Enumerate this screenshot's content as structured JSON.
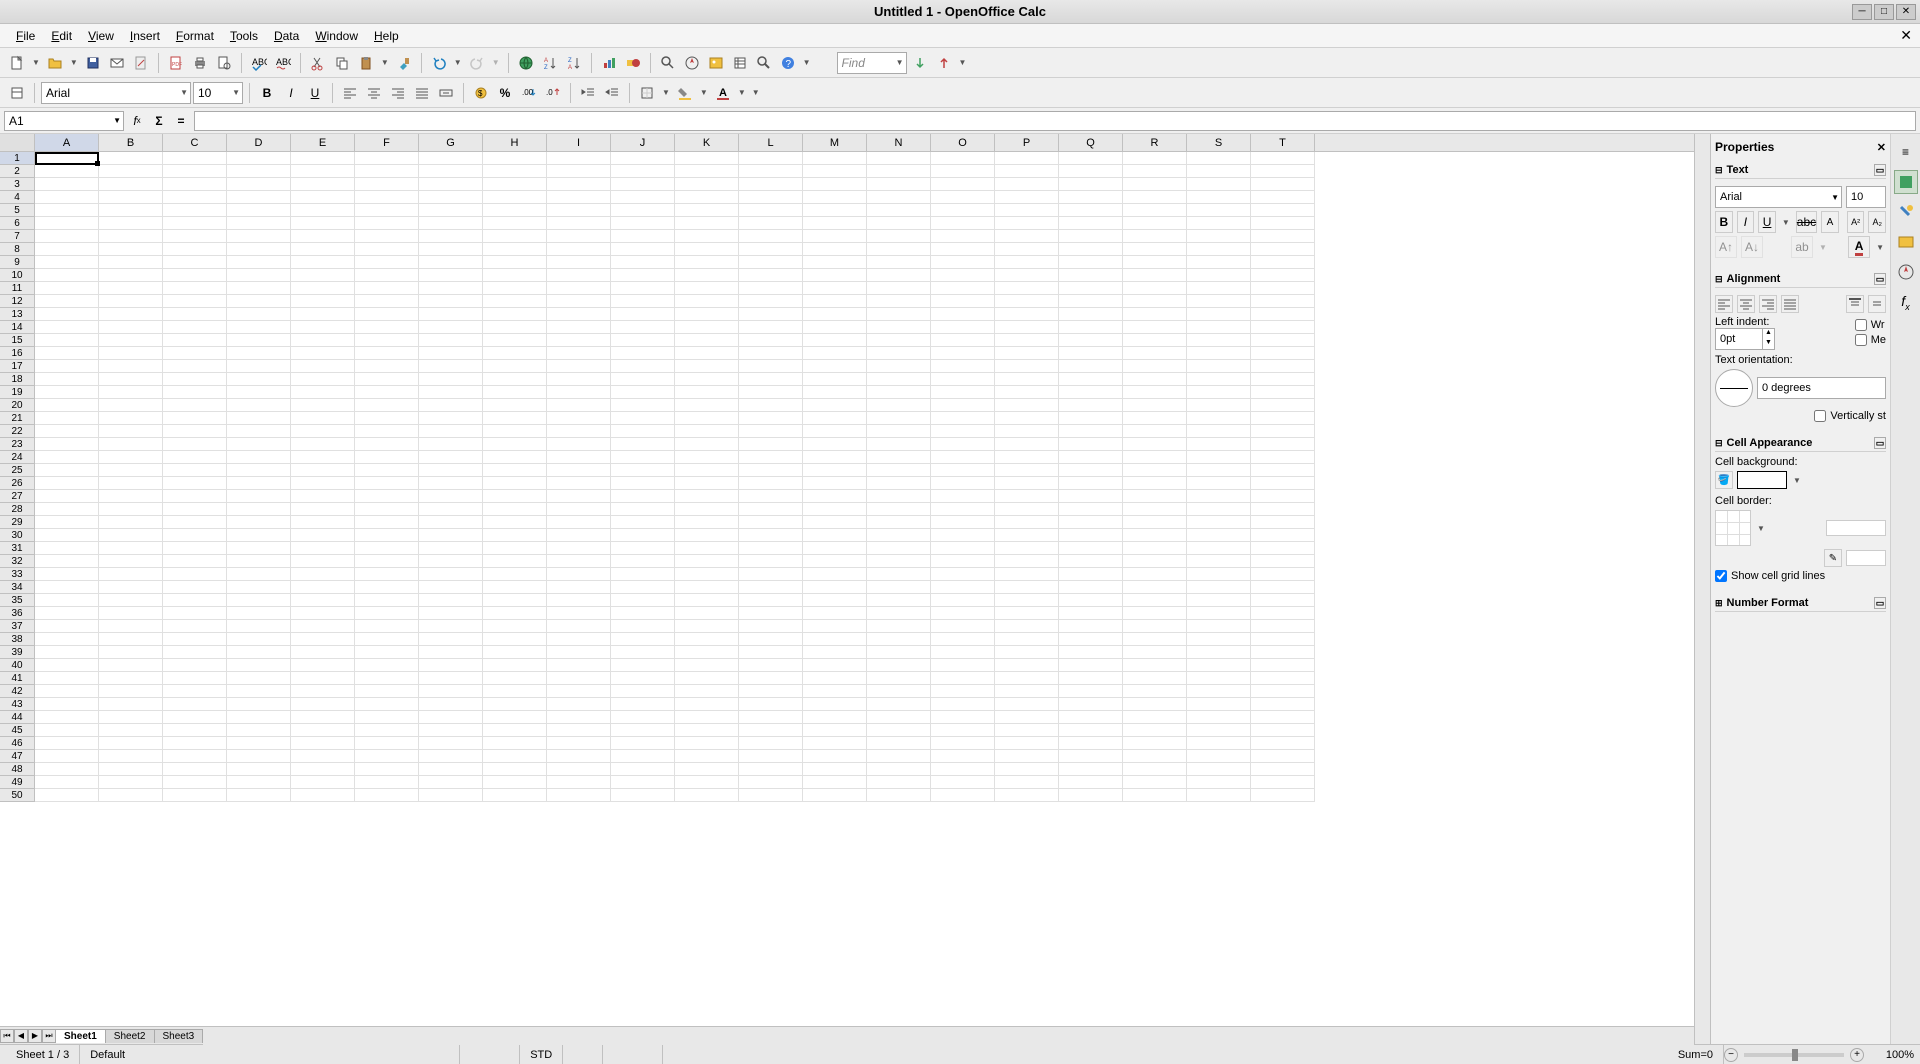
{
  "window": {
    "title": "Untitled 1 - OpenOffice Calc"
  },
  "menu": [
    "File",
    "Edit",
    "View",
    "Insert",
    "Format",
    "Tools",
    "Data",
    "Window",
    "Help"
  ],
  "toolbar": {
    "find_placeholder": "Find"
  },
  "format": {
    "font_name": "Arial",
    "font_size": "10"
  },
  "formula": {
    "cell_ref": "A1",
    "input": ""
  },
  "columns": [
    "A",
    "B",
    "C",
    "D",
    "E",
    "F",
    "G",
    "H",
    "I",
    "J",
    "K",
    "L",
    "M",
    "N",
    "O",
    "P",
    "Q",
    "R",
    "S",
    "T"
  ],
  "row_count": 50,
  "sheets": {
    "active": 0,
    "tabs": [
      "Sheet1",
      "Sheet2",
      "Sheet3"
    ]
  },
  "sidebar": {
    "title": "Properties",
    "text": {
      "title": "Text",
      "font": "Arial",
      "size": "10"
    },
    "alignment": {
      "title": "Alignment",
      "indent_label": "Left indent:",
      "indent_value": "0pt",
      "orient_label": "Text orientation:",
      "orient_value": "0 degrees",
      "wrap_label": "Wr",
      "merge_label": "Me",
      "vstack_label": "Vertically st"
    },
    "cellapp": {
      "title": "Cell Appearance",
      "bg_label": "Cell background:",
      "border_label": "Cell border:",
      "grid_label": "Show cell grid lines",
      "grid_checked": true
    },
    "numfmt": {
      "title": "Number Format"
    }
  },
  "status": {
    "sheet": "Sheet 1 / 3",
    "style": "Default",
    "mode": "STD",
    "sum": "Sum=0",
    "zoom": "100%"
  }
}
